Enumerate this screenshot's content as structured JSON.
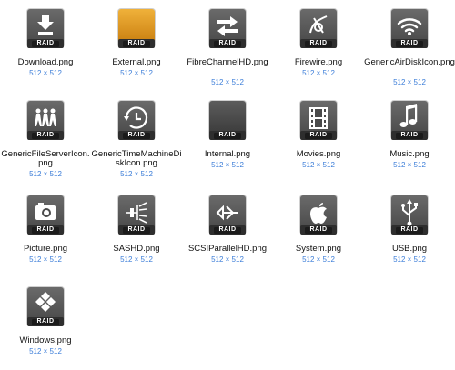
{
  "files": [
    {
      "name": "Download.png",
      "dims": "512 × 512",
      "icon": "download-arrow-icon",
      "variant": "dark",
      "badge": "RAID",
      "name_lines": 1
    },
    {
      "name": "External.png",
      "dims": "512 × 512",
      "icon": "external-drive-icon",
      "variant": "orange",
      "badge": "RAID",
      "name_lines": 1
    },
    {
      "name": "FibreChannelHD.png",
      "dims": "512 × 512",
      "icon": "fibre-channel-icon",
      "variant": "dark",
      "badge": "RAID",
      "name_lines": 2
    },
    {
      "name": "Firewire.png",
      "dims": "512 × 512",
      "icon": "firewire-icon",
      "variant": "dark",
      "badge": "RAID",
      "name_lines": 1
    },
    {
      "name": "GenericAirDiskIcon.png",
      "dims": "512 × 512",
      "icon": "wifi-icon",
      "variant": "dark",
      "badge": "RAID",
      "name_lines": 2
    },
    {
      "name": "GenericFileServerIcon.png",
      "dims": "512 × 512",
      "icon": "people-icon",
      "variant": "dark",
      "badge": "RAID",
      "name_lines": 2
    },
    {
      "name": "GenericTimeMachineDiskIcon.png",
      "dims": "512 × 512",
      "icon": "time-machine-icon",
      "variant": "dark",
      "badge": "RAID",
      "name_lines": 2
    },
    {
      "name": "Internal.png",
      "dims": "512 × 512",
      "icon": "internal-drive-icon",
      "variant": "plain",
      "badge": "RAID",
      "name_lines": 1
    },
    {
      "name": "Movies.png",
      "dims": "512 × 512",
      "icon": "film-icon",
      "variant": "dark",
      "badge": "RAID",
      "name_lines": 1
    },
    {
      "name": "Music.png",
      "dims": "512 × 512",
      "icon": "music-note-icon",
      "variant": "dark",
      "badge": "RAID",
      "name_lines": 1
    },
    {
      "name": "Picture.png",
      "dims": "512 × 512",
      "icon": "camera-icon",
      "variant": "dark",
      "badge": "RAID",
      "name_lines": 1
    },
    {
      "name": "SASHD.png",
      "dims": "512 × 512",
      "icon": "sas-icon",
      "variant": "dark",
      "badge": "RAID",
      "name_lines": 1
    },
    {
      "name": "SCSIParallelHD.png",
      "dims": "512 × 512",
      "icon": "scsi-icon",
      "variant": "dark",
      "badge": "RAID",
      "name_lines": 1
    },
    {
      "name": "System.png",
      "dims": "512 × 512",
      "icon": "apple-icon",
      "variant": "dark",
      "badge": "RAID",
      "name_lines": 1
    },
    {
      "name": "USB.png",
      "dims": "512 × 512",
      "icon": "usb-icon",
      "variant": "dark",
      "badge": "RAID",
      "name_lines": 1
    },
    {
      "name": "Windows.png",
      "dims": "512 × 512",
      "icon": "windows-icon",
      "variant": "dark",
      "badge": "RAID",
      "name_lines": 1
    }
  ],
  "colors": {
    "drive_dark": "#4a4a4a",
    "drive_light": "#6a6a6a",
    "drive_orange": "#f0b13a",
    "drive_orange_dark": "#c97f10",
    "label": "#ffffff",
    "dims": "#3b7dd8"
  }
}
